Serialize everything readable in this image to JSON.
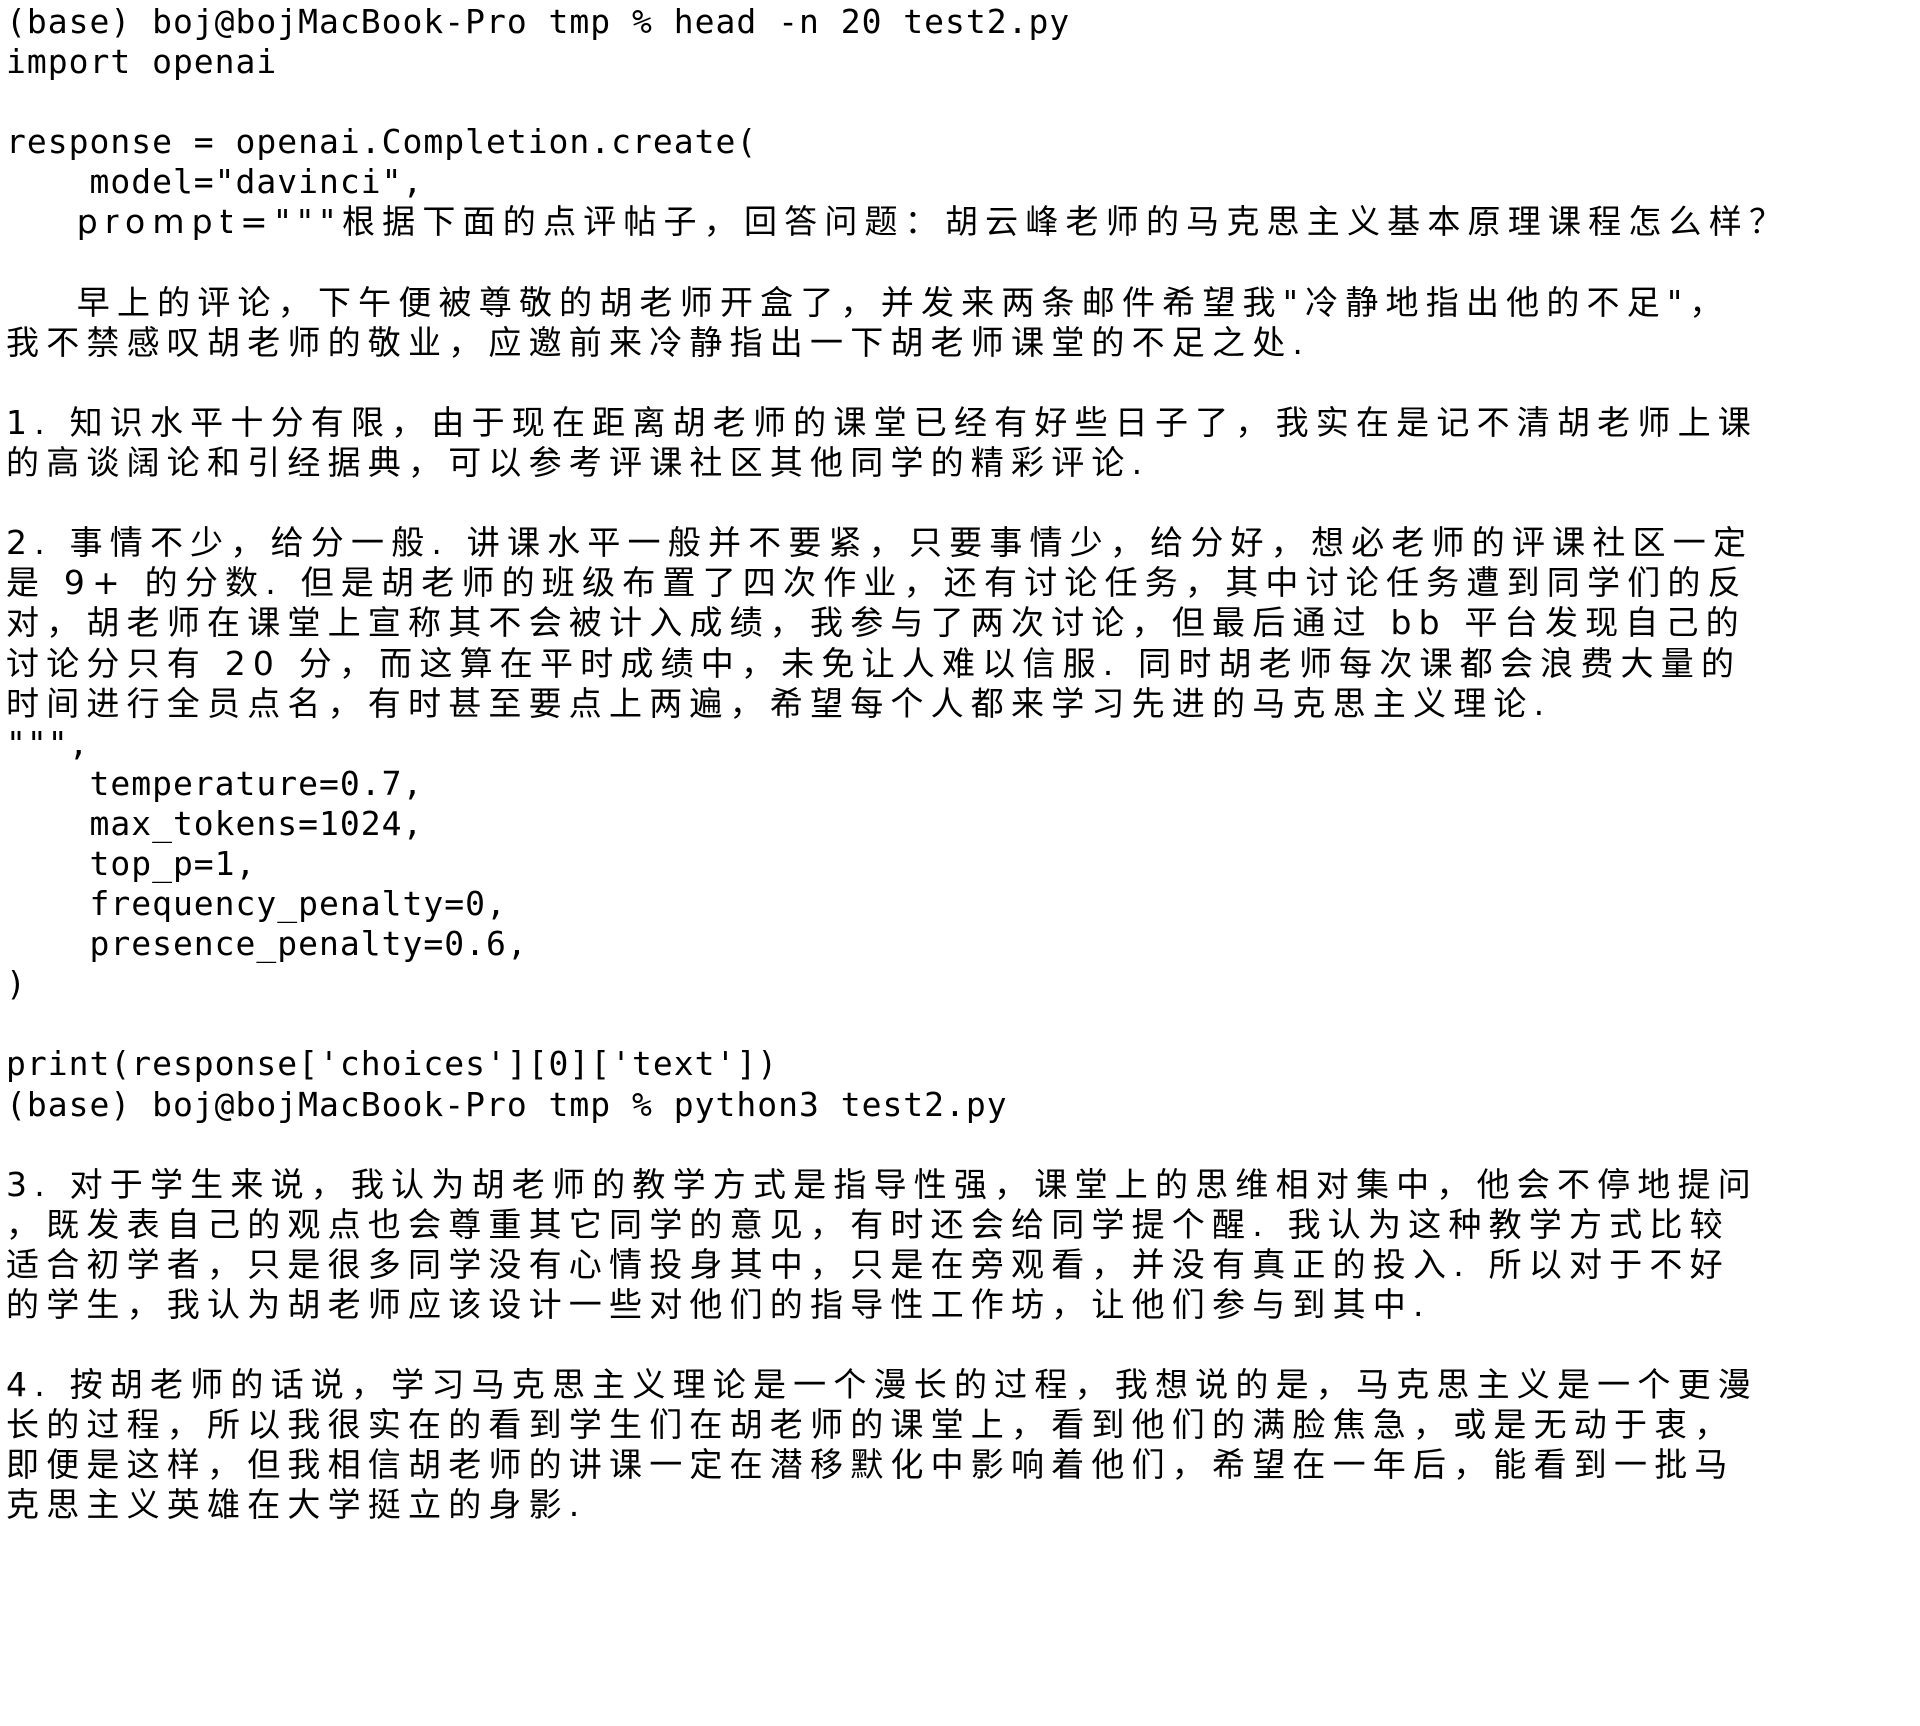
{
  "terminal": {
    "background": "#ffffff",
    "foreground": "#000000",
    "prompt": "(base) boj@bojMacBook-Pro tmp % ",
    "lines": [
      {
        "type": "command",
        "prompt": "(base) boj@bojMacBook-Pro tmp % ",
        "command": "head -n 20 test2.py"
      },
      {
        "type": "code",
        "text": "import openai"
      },
      {
        "type": "code",
        "text": ""
      },
      {
        "type": "code",
        "text": "response = openai.Completion.create("
      },
      {
        "type": "code",
        "text": "    model=\"davinci\","
      },
      {
        "type": "cjk",
        "text": "    prompt=\"\"\"根据下面的点评帖子，回答问题：胡云峰老师的马克思主义基本原理课程怎么样？"
      },
      {
        "type": "code",
        "text": ""
      },
      {
        "type": "cjk",
        "text": "    早上的评论，下午便被尊敬的胡老师开盒了，并发来两条邮件希望我\"冷静地指出他的不足\"，"
      },
      {
        "type": "cjk",
        "text": "我不禁感叹胡老师的敬业，应邀前来冷静指出一下胡老师课堂的不足之处."
      },
      {
        "type": "code",
        "text": ""
      },
      {
        "type": "cjk",
        "text": "1. 知识水平十分有限，由于现在距离胡老师的课堂已经有好些日子了，我实在是记不清胡老师上课"
      },
      {
        "type": "cjk",
        "text": "的高谈阔论和引经据典，可以参考评课社区其他同学的精彩评论."
      },
      {
        "type": "code",
        "text": ""
      },
      {
        "type": "cjk",
        "text": "2. 事情不少，给分一般. 讲课水平一般并不要紧，只要事情少，给分好，想必老师的评课社区一定"
      },
      {
        "type": "cjk",
        "text": "是 9+ 的分数. 但是胡老师的班级布置了四次作业，还有讨论任务，其中讨论任务遭到同学们的反"
      },
      {
        "type": "cjk",
        "text": "对，胡老师在课堂上宣称其不会被计入成绩，我参与了两次讨论，但最后通过 bb 平台发现自己的"
      },
      {
        "type": "cjk",
        "text": "讨论分只有 20 分，而这算在平时成绩中，未免让人难以信服. 同时胡老师每次课都会浪费大量的"
      },
      {
        "type": "cjk",
        "text": "时间进行全员点名，有时甚至要点上两遍，希望每个人都来学习先进的马克思主义理论."
      },
      {
        "type": "code",
        "text": "\"\"\","
      },
      {
        "type": "code",
        "text": "    temperature=0.7,"
      },
      {
        "type": "code",
        "text": "    max_tokens=1024,"
      },
      {
        "type": "code",
        "text": "    top_p=1,"
      },
      {
        "type": "code",
        "text": "    frequency_penalty=0,"
      },
      {
        "type": "code",
        "text": "    presence_penalty=0.6,"
      },
      {
        "type": "code",
        "text": ")"
      },
      {
        "type": "code",
        "text": ""
      },
      {
        "type": "code",
        "text": "print(response['choices'][0]['text'])"
      },
      {
        "type": "command",
        "prompt": "(base) boj@bojMacBook-Pro tmp % ",
        "command": "python3 test2.py"
      },
      {
        "type": "code",
        "text": ""
      },
      {
        "type": "cjk",
        "text": "3. 对于学生来说，我认为胡老师的教学方式是指导性强，课堂上的思维相对集中，他会不停地提问"
      },
      {
        "type": "cjk",
        "text": "，既发表自己的观点也会尊重其它同学的意见，有时还会给同学提个醒. 我认为这种教学方式比较"
      },
      {
        "type": "cjk",
        "text": "适合初学者，只是很多同学没有心情投身其中，只是在旁观看，并没有真正的投入. 所以对于不好"
      },
      {
        "type": "cjk",
        "text": "的学生，我认为胡老师应该设计一些对他们的指导性工作坊，让他们参与到其中."
      },
      {
        "type": "code",
        "text": ""
      },
      {
        "type": "cjk",
        "text": "4. 按胡老师的话说，学习马克思主义理论是一个漫长的过程，我想说的是，马克思主义是一个更漫"
      },
      {
        "type": "cjk",
        "text": "长的过程，所以我很实在的看到学生们在胡老师的课堂上，看到他们的满脸焦急，或是无动于衷，"
      },
      {
        "type": "cjk",
        "text": "即便是这样，但我相信胡老师的讲课一定在潜移默化中影响着他们，希望在一年后，能看到一批马"
      },
      {
        "type": "cjk",
        "text": "克思主义英雄在大学挺立的身影."
      }
    ]
  }
}
